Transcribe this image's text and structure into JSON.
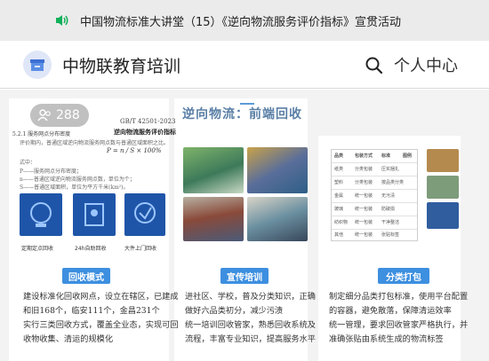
{
  "top_bar": {
    "title": "中国物流标准大讲堂（15）《逆向物流服务评价指标》宣贯活动"
  },
  "header": {
    "brand": "中物联教育培训",
    "profile_label": "个人中心"
  },
  "views": {
    "count": "288"
  },
  "banner": {
    "center_title": "逆向物流：前端回收",
    "doc": {
      "standard_no": "GB/T 42501-2023",
      "doc_title": "逆向物流服务评价指标",
      "section": "5.2.1  服务网点分布密度",
      "lines": [
        "评价期内，普通区域逆向物流服务网点数与普通区域面积之比。",
        "式中：",
        "P——服务网点分布密度；",
        "n——普通区域逆向物流服务网点数，单位为个；",
        "S——普通区域面积，单位为平方千米(km²)。"
      ],
      "formula": "P = n / S × 100%",
      "tile_captions": [
        "定期定点回收",
        "24h自助回收",
        "大件上门回收"
      ]
    },
    "tags": {
      "left": "回收模式",
      "middle": "宣传培训",
      "right": "分类打包"
    },
    "left_desc": "建设标准化回收网点，设立在辖区，已建成\n和旧168个，临安111个，金昌231个\n实行三类回收方式，覆盖全业态，实现可回\n收物收集、清运的规模化",
    "middle_desc": "进社区、学校，普及分类知识，正确\n做好六品类初分，减少污渍\n统一培训回收管家，熟悉回收系统及\n流程，丰富专业知识，提高服务水平",
    "right_desc": "制定细分品类打包标准，使用平台配置\n的容器，避免散落，保障清运效率\n统一管理，要求回收管家严格执行，并\n准确张贴由系统生成的物流标签",
    "table": {
      "headers": [
        "品类",
        "包装方式",
        "标准",
        "图例"
      ],
      "rows": [
        [
          "纸类",
          "分类包装",
          "压实捆扎"
        ],
        [
          "塑料",
          "分类包装",
          "按品类分类"
        ],
        [
          "金属",
          "统一包装",
          "无污渍"
        ],
        [
          "玻璃",
          "统一包装",
          "防破损"
        ],
        [
          "纺织物",
          "统一包装",
          "干净整洁"
        ],
        [
          "其他",
          "统一包装",
          "张贴标签"
        ]
      ]
    }
  },
  "colors": {
    "accent": "#3d8fe0",
    "speaker": "#12b15a",
    "brand_bg": "#dfe6f7",
    "title_blue": "#5a7fa6"
  },
  "icons": [
    "speaker-icon",
    "brand-logo-icon",
    "search-icon",
    "eye-icon"
  ]
}
